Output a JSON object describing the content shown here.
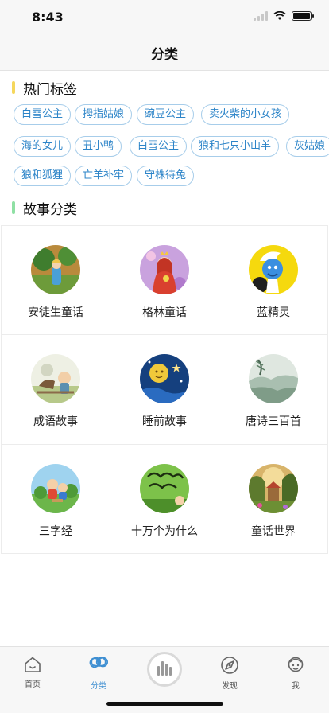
{
  "status_bar": {
    "time": "8:43"
  },
  "nav": {
    "title": "分类"
  },
  "hot_tags": {
    "title": "热门标签",
    "accent": "#f5d75c",
    "items": [
      "白雪公主",
      "拇指姑娘",
      "豌豆公主",
      "卖火柴的小女孩",
      "海的女儿",
      "丑小鸭",
      "白雪公主",
      "狼和七只小山羊",
      "灰姑娘",
      "狼和狐狸",
      "亡羊补牢",
      "守株待兔"
    ]
  },
  "story_categories": {
    "title": "故事分类",
    "accent": "#8fe0a4",
    "items": [
      {
        "label": "安徒生童话",
        "icon": "andersen-cover-icon"
      },
      {
        "label": "格林童话",
        "icon": "grimm-cover-icon"
      },
      {
        "label": "蓝精灵",
        "icon": "smurf-cover-icon"
      },
      {
        "label": "成语故事",
        "icon": "idiom-cover-icon"
      },
      {
        "label": "睡前故事",
        "icon": "bedtime-cover-icon"
      },
      {
        "label": "唐诗三百首",
        "icon": "tang-poem-cover-icon"
      },
      {
        "label": "三字经",
        "icon": "three-character-cover-icon"
      },
      {
        "label": "十万个为什么",
        "icon": "why-cover-icon"
      },
      {
        "label": "童话世界",
        "icon": "fairy-world-cover-icon"
      }
    ]
  },
  "tab_bar": {
    "items": [
      {
        "label": "首页",
        "icon": "home-icon",
        "active": false
      },
      {
        "label": "分类",
        "icon": "category-icon",
        "active": true
      },
      {
        "label": "",
        "icon": "audio-bars-icon",
        "active": false
      },
      {
        "label": "发现",
        "icon": "discover-icon",
        "active": false
      },
      {
        "label": "我",
        "icon": "profile-icon",
        "active": false
      }
    ],
    "active_color": "#3f8fd2"
  },
  "colors": {
    "tag_border": "#a7cdea",
    "tag_text": "#2c84c8"
  }
}
